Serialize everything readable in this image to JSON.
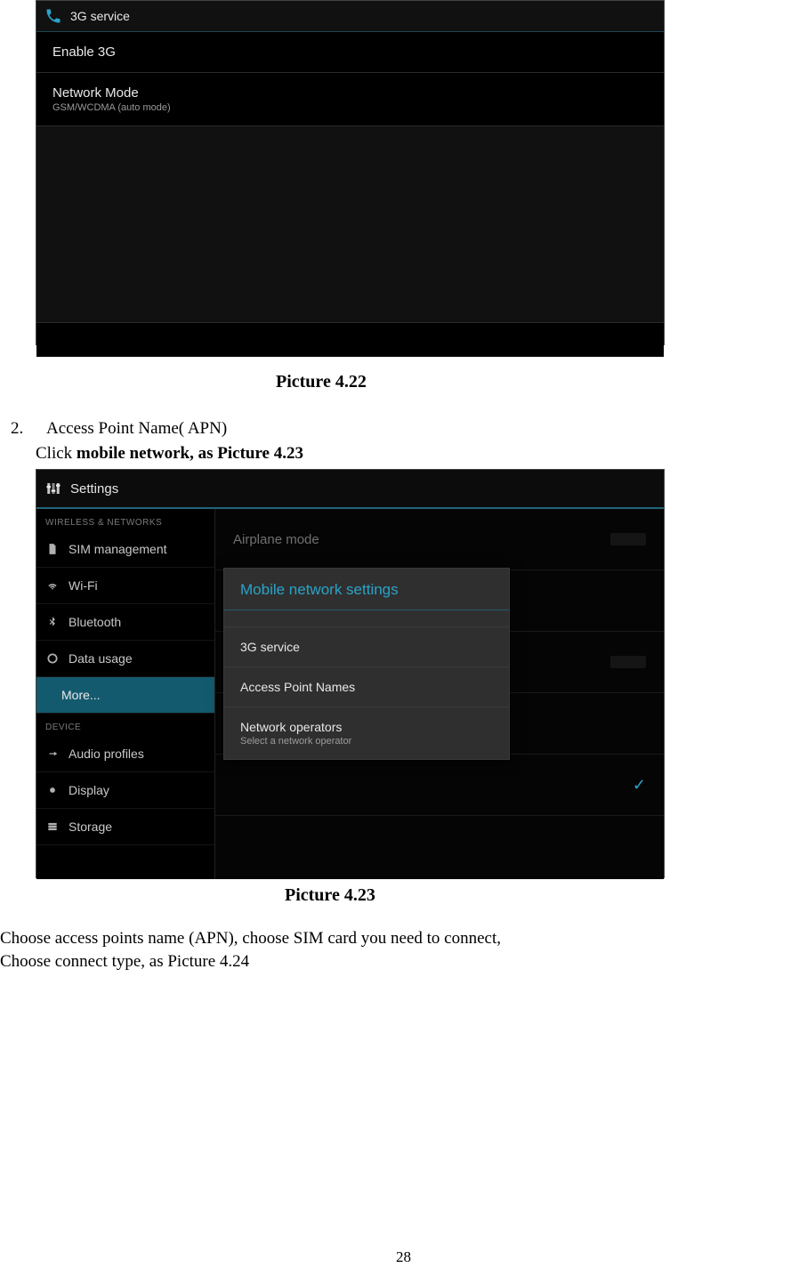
{
  "shot1": {
    "title": "3G service",
    "rows": [
      {
        "label": "Enable 3G"
      },
      {
        "label": "Network Mode",
        "sub": "GSM/WCDMA (auto mode)"
      }
    ]
  },
  "caption1": "Picture 4.22",
  "list": {
    "num": "2.",
    "text": "Access Point Name( APN)",
    "click_prefix": "Click ",
    "click_bold": "mobile network, as Picture 4.23"
  },
  "shot2": {
    "title": "Settings",
    "sidebar": {
      "cat1": "WIRELESS & NETWORKS",
      "items1": [
        {
          "label": "SIM management",
          "icon": "sim"
        },
        {
          "label": "Wi-Fi",
          "icon": "wifi"
        },
        {
          "label": "Bluetooth",
          "icon": "bt"
        },
        {
          "label": "Data usage",
          "icon": "data"
        },
        {
          "label": "More...",
          "icon": "",
          "selected": true
        }
      ],
      "cat2": "DEVICE",
      "items2": [
        {
          "label": "Audio profiles",
          "icon": "audio"
        },
        {
          "label": "Display",
          "icon": "display"
        },
        {
          "label": "Storage",
          "icon": "storage"
        }
      ]
    },
    "main": {
      "airplane": "Airplane mode"
    },
    "dialog": {
      "title": "Mobile network settings",
      "options": [
        {
          "label": "3G service"
        },
        {
          "label": "Access Point Names"
        },
        {
          "label": "Network operators",
          "sub": "Select a network operator"
        }
      ]
    }
  },
  "caption2": "Picture 4.23",
  "para0": "Choose access points name (APN), choose SIM card you need to connect,",
  "para1": "Choose connect type, as Picture 4.24",
  "page_number": "28"
}
